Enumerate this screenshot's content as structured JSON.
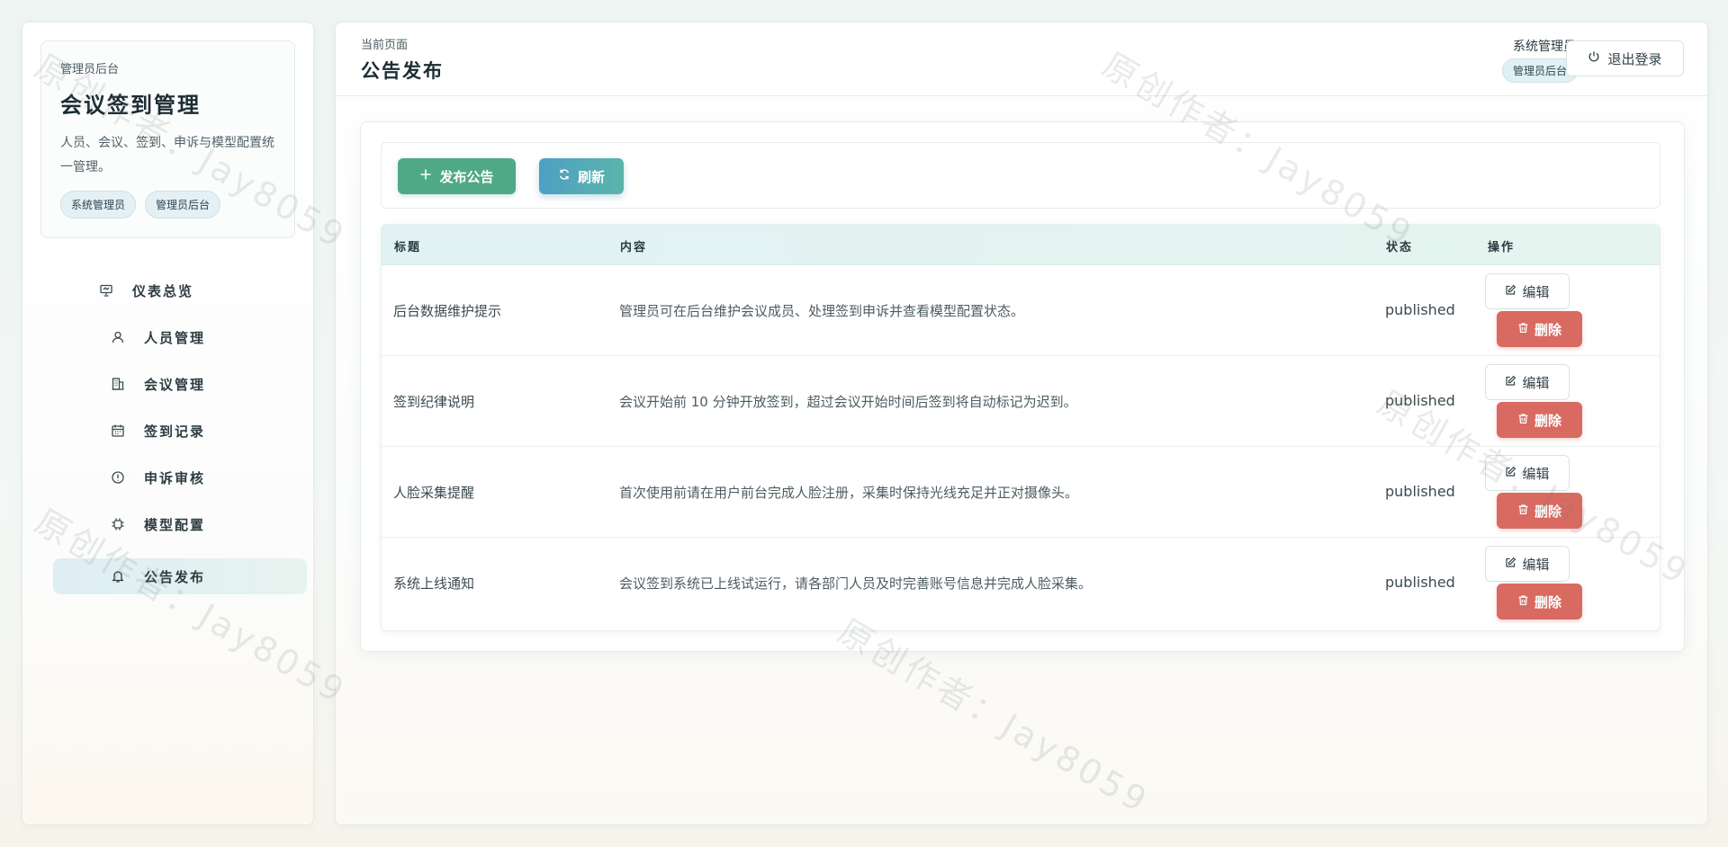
{
  "sidebar": {
    "eyebrow": "管理员后台",
    "title": "会议签到管理",
    "description": "人员、会议、签到、申诉与模型配置统一管理。",
    "tags": [
      "系统管理员",
      "管理员后台"
    ],
    "nav": [
      {
        "label": "仪表总览",
        "icon": "presentation-icon",
        "active": false
      },
      {
        "label": "人员管理",
        "icon": "user-icon",
        "active": false
      },
      {
        "label": "会议管理",
        "icon": "building-icon",
        "active": false
      },
      {
        "label": "签到记录",
        "icon": "calendar-icon",
        "active": false
      },
      {
        "label": "申诉审核",
        "icon": "alert-circle-icon",
        "active": false
      },
      {
        "label": "模型配置",
        "icon": "chip-icon",
        "active": false
      },
      {
        "label": "公告发布",
        "icon": "bell-icon",
        "active": true
      }
    ]
  },
  "header": {
    "breadcrumb": "当前页面",
    "title": "公告发布",
    "user_name": "系统管理员",
    "user_role": "管理员后台",
    "logout_label": "退出登录"
  },
  "toolbar": {
    "publish_label": "发布公告",
    "refresh_label": "刷新"
  },
  "table": {
    "columns": [
      "标题",
      "内容",
      "状态",
      "操作"
    ],
    "rows": [
      {
        "title": "后台数据维护提示",
        "content": "管理员可在后台维护会议成员、处理签到申诉并查看模型配置状态。",
        "status": "published"
      },
      {
        "title": "签到纪律说明",
        "content": "会议开始前 10 分钟开放签到，超过会议开始时间后签到将自动标记为迟到。",
        "status": "published"
      },
      {
        "title": "人脸采集提醒",
        "content": "首次使用前请在用户前台完成人脸注册，采集时保持光线充足并正对摄像头。",
        "status": "published"
      },
      {
        "title": "系统上线通知",
        "content": "会议签到系统已上线试运行，请各部门人员及时完善账号信息并完成人脸采集。",
        "status": "published"
      }
    ],
    "edit_label": "编辑",
    "delete_label": "删除"
  },
  "watermark": "原创作者：Jay8059",
  "colors": {
    "primary_green": "#4fa987",
    "refresh_blue": "#4f9fc4",
    "danger_red": "#d86a62",
    "header_row_bg": "#e2f1f3"
  }
}
